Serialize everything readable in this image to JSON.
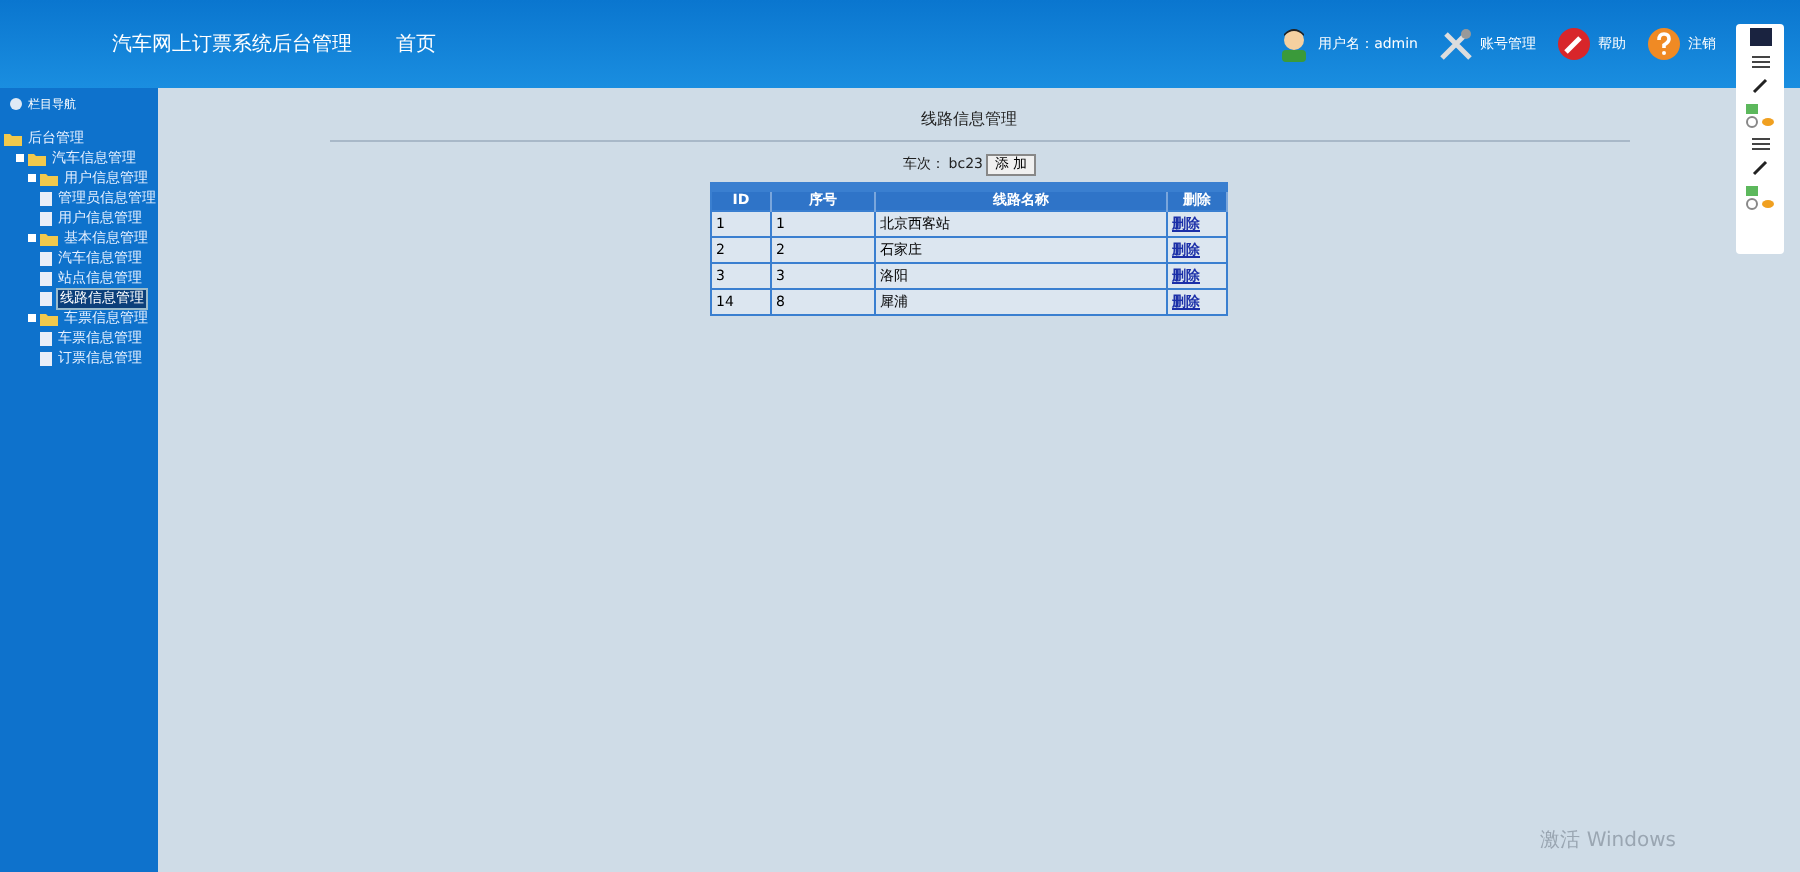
{
  "header": {
    "title": "汽车网上订票系统后台管理",
    "nav": [
      {
        "label": "首页"
      }
    ],
    "actions": [
      {
        "kind": "user",
        "label": "用户名：admin"
      },
      {
        "kind": "account",
        "label": "账号管理"
      },
      {
        "kind": "help",
        "label": "帮助"
      },
      {
        "kind": "logout",
        "label": "注销"
      }
    ]
  },
  "sidebar": {
    "heading": "栏目导航",
    "tree": [
      {
        "label": "后台管理",
        "selected": false,
        "children": [
          {
            "label": "汽车信息管理",
            "selected": false,
            "children": [
              {
                "label": "用户信息管理",
                "selected": false,
                "children": [
                  {
                    "label": "管理员信息管理",
                    "selected": false
                  },
                  {
                    "label": "用户信息管理",
                    "selected": false
                  }
                ]
              },
              {
                "label": "基本信息管理",
                "selected": false,
                "children": [
                  {
                    "label": "汽车信息管理",
                    "selected": false
                  },
                  {
                    "label": "站点信息管理",
                    "selected": false
                  },
                  {
                    "label": "线路信息管理",
                    "selected": true
                  }
                ]
              },
              {
                "label": "车票信息管理",
                "selected": false,
                "children": [
                  {
                    "label": "车票信息管理",
                    "selected": false
                  },
                  {
                    "label": "订票信息管理",
                    "selected": false
                  }
                ]
              }
            ]
          }
        ]
      }
    ]
  },
  "main": {
    "title": "线路信息管理",
    "filter_label": "车次：",
    "filter_value": "bc23",
    "add_button": "添 加",
    "table": {
      "columns": [
        "ID",
        "序号",
        "线路名称",
        "删除"
      ],
      "rows": [
        {
          "id": "1",
          "order": "1",
          "name": "北京西客站",
          "action": "删除"
        },
        {
          "id": "2",
          "order": "2",
          "name": "石家庄",
          "action": "删除"
        },
        {
          "id": "3",
          "order": "3",
          "name": "洛阳",
          "action": "删除"
        },
        {
          "id": "14",
          "order": "8",
          "name": "犀浦",
          "action": "删除"
        }
      ]
    }
  },
  "os_notice": "激活 Windows"
}
